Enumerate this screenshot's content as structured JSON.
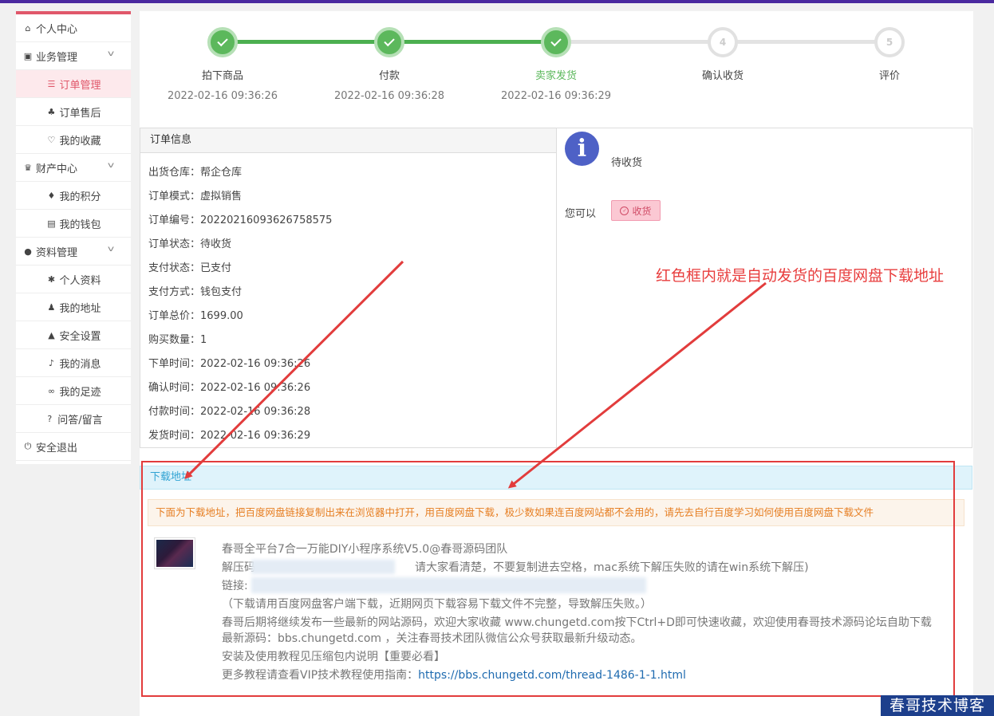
{
  "sidebar": {
    "items": [
      {
        "label": "个人中心",
        "icon": "home-icon",
        "type": "top"
      },
      {
        "label": "业务管理",
        "icon": "cube-icon",
        "type": "top",
        "chevron": true
      },
      {
        "label": "订单管理",
        "icon": "list-icon",
        "type": "sub",
        "active": true
      },
      {
        "label": "订单售后",
        "icon": "sitemap-icon",
        "type": "sub"
      },
      {
        "label": "我的收藏",
        "icon": "heart-icon",
        "type": "sub"
      },
      {
        "label": "财产中心",
        "icon": "trophy-icon",
        "type": "top",
        "chevron": true
      },
      {
        "label": "我的积分",
        "icon": "fire-icon",
        "type": "sub"
      },
      {
        "label": "我的钱包",
        "icon": "wallet-icon",
        "type": "sub"
      },
      {
        "label": "资料管理",
        "icon": "user-icon",
        "type": "top",
        "chevron": true
      },
      {
        "label": "个人资料",
        "icon": "gear-icon",
        "type": "sub"
      },
      {
        "label": "我的地址",
        "icon": "person-icon",
        "type": "sub"
      },
      {
        "label": "安全设置",
        "icon": "lock-icon",
        "type": "sub"
      },
      {
        "label": "我的消息",
        "icon": "bell-icon",
        "type": "sub"
      },
      {
        "label": "我的足迹",
        "icon": "footprint-icon",
        "type": "sub"
      },
      {
        "label": "问答/留言",
        "icon": "question-icon",
        "type": "sub"
      },
      {
        "label": "安全退出",
        "icon": "power-icon",
        "type": "top"
      }
    ]
  },
  "steps": [
    {
      "num": "1",
      "label": "拍下商品",
      "time": "2022-02-16 09:36:26",
      "done": true
    },
    {
      "num": "2",
      "label": "付款",
      "time": "2022-02-16 09:36:28",
      "done": true
    },
    {
      "num": "3",
      "label": "卖家发货",
      "time": "2022-02-16 09:36:29",
      "done": true,
      "current": true
    },
    {
      "num": "4",
      "label": "确认收货",
      "time": "",
      "done": false
    },
    {
      "num": "5",
      "label": "评价",
      "time": "",
      "done": false
    }
  ],
  "order": {
    "title": "订单信息",
    "rows": [
      {
        "k": "出货仓库：",
        "v": "帮企仓库"
      },
      {
        "k": "订单模式：",
        "v": "虚拟销售"
      },
      {
        "k": "订单编号：",
        "v": "20220216093626758575"
      },
      {
        "k": "订单状态：",
        "v": "待收货"
      },
      {
        "k": "支付状态：",
        "v": "已支付"
      },
      {
        "k": "支付方式：",
        "v": "钱包支付"
      },
      {
        "k": "订单总价：",
        "v": "1699.00"
      },
      {
        "k": "购买数量：",
        "v": "1"
      },
      {
        "k": "下单时间：",
        "v": "2022-02-16 09:36:26"
      },
      {
        "k": "确认时间：",
        "v": "2022-02-16 09:36:26"
      },
      {
        "k": "付款时间：",
        "v": "2022-02-16 09:36:28"
      },
      {
        "k": "发货时间：",
        "v": "2022-02-16 09:36:29"
      }
    ],
    "status": "待收货",
    "can_do": "您可以",
    "receive_button": "收货",
    "info_icon": "i"
  },
  "annotation": "红色框内就是自动发货的百度网盘下载地址",
  "download": {
    "title": "下载地址",
    "note": "下面为下载地址，把百度网盘链接复制出来在浏览器中打开，用百度网盘下载，极少数如果连百度网站都不会用的，请先去自行百度学习如何使用百度网盘下载文件",
    "lines": {
      "title": "春哥全平台7合一万能DIY小程序系统V5.0@春哥源码团队",
      "pwd_prefix": "解压码",
      "pwd_suffix": "请大家看清楚，不要复制进去空格，mac系统下解压失败的请在win系统下解压)",
      "link_prefix": "链接:",
      "tip": "（下载请用百度网盘客户端下载，近期网页下载容易下载文件不完整，导致解压失败。）",
      "promo1": "春哥后期将继续发布一些最新的网站源码，欢迎大家收藏 www.chungetd.com按下Ctrl+D即可快速收藏，欢迎使用春哥技术源码论坛自助下载",
      "promo2": "最新源码：bbs.chungetd.com ，关注春哥技术团队微信公众号获取最新升级动态。",
      "install": "安装及使用教程见压缩包内说明【重要必看】",
      "more_prefix": "更多教程请查看VIP技术教程使用指南：",
      "more_link": "https://bbs.chungetd.com/thread-1486-1-1.html"
    }
  },
  "watermark": "春哥技术博客",
  "colors": {
    "accent": "#e0576a",
    "success": "#5cb85c",
    "annotation": "#e23c3c"
  }
}
